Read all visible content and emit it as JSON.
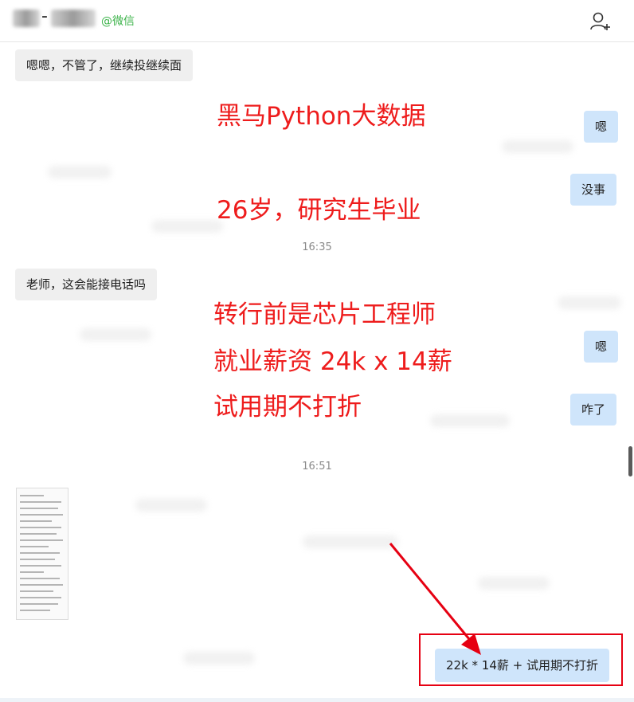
{
  "header": {
    "source_tag": "@微信",
    "add_contact_icon": "add-user-icon"
  },
  "messages": [
    {
      "side": "in",
      "text": "嗯嗯，不管了，继续投继续面"
    },
    {
      "side": "out",
      "text": "嗯"
    },
    {
      "side": "out",
      "text": "没事"
    },
    {
      "side": "time",
      "text": "16:35"
    },
    {
      "side": "in",
      "text": "老师，这会能接电话吗"
    },
    {
      "side": "out",
      "text": "嗯"
    },
    {
      "side": "out",
      "text": "咋了"
    },
    {
      "side": "time",
      "text": "16:51"
    },
    {
      "side": "out",
      "text": "22k *  14薪 +  试用期不打折"
    }
  ],
  "overlay_text": [
    "黑马Python大数据",
    "26岁，研究生毕业",
    "转行前是芯片工程师",
    "就业薪资  24k x 14薪",
    "试用期不打折"
  ],
  "colors": {
    "overlay_red": "#ee1c1c",
    "outgoing_bubble": "#cfe5fb",
    "incoming_bubble": "#efefef",
    "wechat_green": "#3cb34a"
  }
}
